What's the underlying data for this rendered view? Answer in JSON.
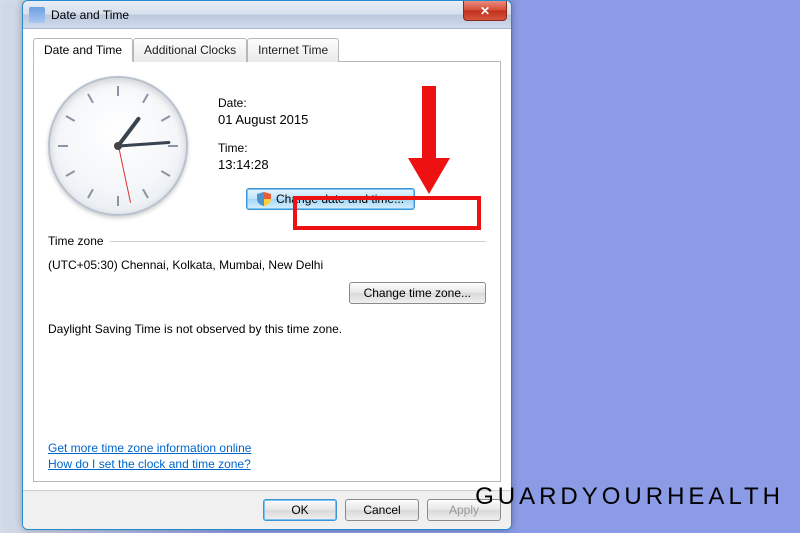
{
  "window": {
    "title": "Date and Time",
    "close_glyph": "✕"
  },
  "tabs": [
    {
      "label": "Date and Time"
    },
    {
      "label": "Additional Clocks"
    },
    {
      "label": "Internet Time"
    }
  ],
  "datetime": {
    "date_label": "Date:",
    "date_value": "01 August 2015",
    "time_label": "Time:",
    "time_value": "13:14:28",
    "change_button": "Change date and time..."
  },
  "timezone": {
    "section_label": "Time zone",
    "value": "(UTC+05:30) Chennai, Kolkata, Mumbai, New Delhi",
    "change_button": "Change time zone..."
  },
  "dst_text": "Daylight Saving Time is not observed by this time zone.",
  "links": {
    "more_info": "Get more time zone information online",
    "howto": "How do I set the clock and time zone?"
  },
  "footer": {
    "ok": "OK",
    "cancel": "Cancel",
    "apply": "Apply"
  },
  "watermark": "GUARDYOURHEALTH"
}
